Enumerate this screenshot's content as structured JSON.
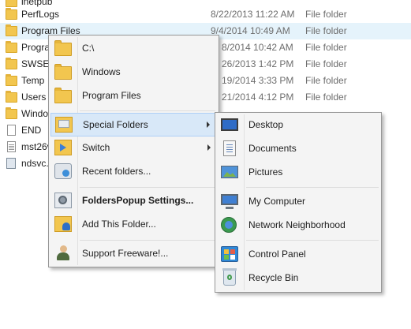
{
  "explorer": {
    "rows": [
      {
        "name": "inetpub",
        "date": "",
        "type": "",
        "icon": "folder-icon"
      },
      {
        "name": "PerfLogs",
        "date": "8/22/2013 11:22 AM",
        "type": "File folder",
        "icon": "folder-icon"
      },
      {
        "name": "Program Files",
        "date": "9/4/2014 10:49 AM",
        "type": "File folder",
        "icon": "folder-icon"
      },
      {
        "name": "Progra",
        "date": "8/2014 10:42 AM",
        "type": "File folder",
        "icon": "folder-icon"
      },
      {
        "name": "SWSET",
        "date": "26/2013 1:42 PM",
        "type": "File folder",
        "icon": "folder-icon"
      },
      {
        "name": "Temp",
        "date": "19/2014 3:33 PM",
        "type": "File folder",
        "icon": "folder-icon"
      },
      {
        "name": "Users",
        "date": "21/2014 4:12 PM",
        "type": "File folder",
        "icon": "folder-icon"
      },
      {
        "name": "Windo",
        "date": "",
        "type": "",
        "icon": "folder-icon"
      },
      {
        "name": "END",
        "date": "",
        "type": "",
        "icon": "file-icon"
      },
      {
        "name": "mst26v",
        "date": "",
        "type": "",
        "icon": "text-file-icon"
      },
      {
        "name": "ndsvc.",
        "date": "",
        "type": "",
        "icon": "service-file-icon"
      }
    ]
  },
  "main_menu": {
    "items": [
      {
        "label": "C:\\",
        "icon": "folder-icon",
        "bold": false,
        "submenu": false
      },
      {
        "label": "Windows",
        "icon": "folder-icon",
        "bold": false,
        "submenu": false
      },
      {
        "label": "Program Files",
        "icon": "folder-icon",
        "bold": false,
        "submenu": false
      },
      {
        "label": "Special Folders",
        "icon": "special-folders-icon",
        "bold": false,
        "submenu": true
      },
      {
        "label": "Switch",
        "icon": "switch-icon",
        "bold": false,
        "submenu": true
      },
      {
        "label": "Recent folders...",
        "icon": "recent-folders-icon",
        "bold": false,
        "submenu": false
      },
      {
        "label": "FoldersPopup Settings...",
        "icon": "settings-icon",
        "bold": true,
        "submenu": false
      },
      {
        "label": "Add This Folder...",
        "icon": "add-folder-icon",
        "bold": false,
        "submenu": false
      },
      {
        "label": "Support Freeware!...",
        "icon": "support-icon",
        "bold": false,
        "submenu": false
      }
    ],
    "highlighted": "Special Folders"
  },
  "sub_menu": {
    "items": [
      {
        "label": "Desktop",
        "icon": "desktop-icon"
      },
      {
        "label": "Documents",
        "icon": "documents-icon"
      },
      {
        "label": "Pictures",
        "icon": "pictures-icon"
      },
      {
        "label": "My Computer",
        "icon": "computer-icon"
      },
      {
        "label": "Network Neighborhood",
        "icon": "network-icon"
      },
      {
        "label": "Control Panel",
        "icon": "control-panel-icon"
      },
      {
        "label": "Recycle Bin",
        "icon": "recycle-bin-icon"
      }
    ]
  },
  "colors": {
    "highlight_bg": "#d8e8f8",
    "highlight_border": "#aecff7",
    "menu_bg": "#f4f4f4",
    "folder_yellow": "#f2c64f"
  }
}
